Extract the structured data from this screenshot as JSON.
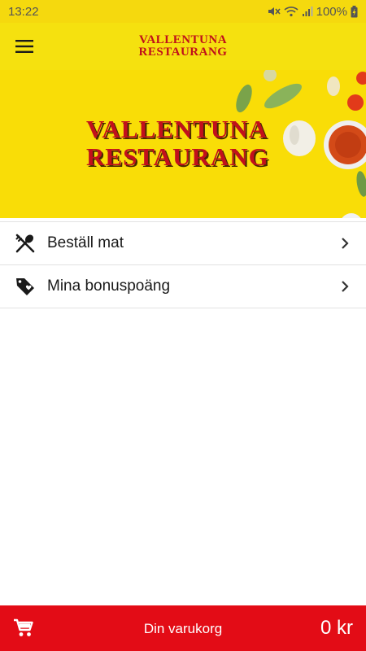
{
  "status": {
    "time": "13:22",
    "battery": "100%"
  },
  "appbar": {
    "logo_line1": "VALLENTUNA",
    "logo_line2": "RESTAURANG"
  },
  "banner": {
    "title_line1": "VALLENTUNA",
    "title_line2": "RESTAURANG"
  },
  "menu": {
    "items": [
      {
        "label": "Beställ mat",
        "icon": "fork-spoon-icon"
      },
      {
        "label": "Mina bonuspoäng",
        "icon": "tag-heart-icon"
      }
    ]
  },
  "cart": {
    "label": "Din varukorg",
    "total": "0 kr",
    "icon": "cart-icon"
  },
  "colors": {
    "appbar": "#f5e10f",
    "brand_red": "#c0101a",
    "cartbar": "#e30c16"
  }
}
